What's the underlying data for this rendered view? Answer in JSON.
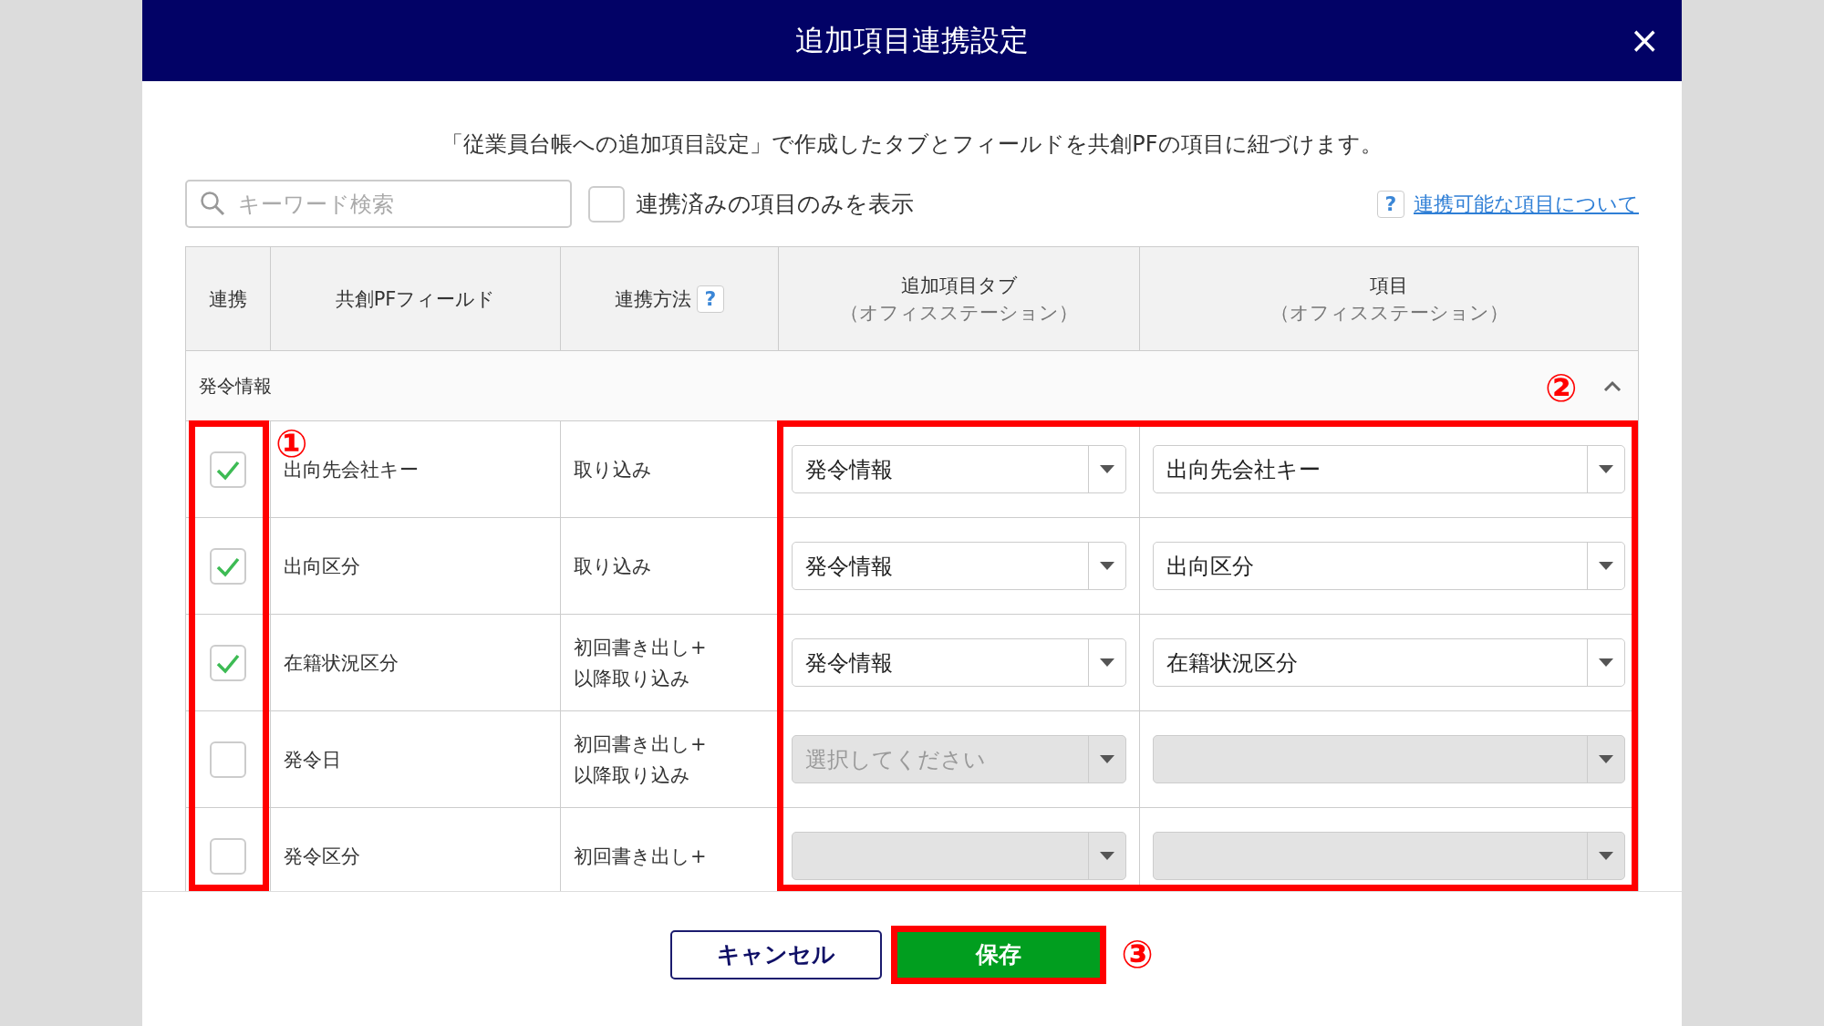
{
  "dialog": {
    "title": "追加項目連携設定",
    "close": "×"
  },
  "description": "「従業員台帳への追加項目設定」で作成したタブとフィールドを共創PFの項目に紐づけます。",
  "search": {
    "placeholder": "キーワード検索"
  },
  "filter": {
    "label": "連携済みの項目のみを表示",
    "checked": false
  },
  "help_link": {
    "icon": "?",
    "label": "連携可能な項目について"
  },
  "table": {
    "columns": [
      {
        "label": "連携"
      },
      {
        "label": "共創PFフィールド"
      },
      {
        "label": "連携方法",
        "help": "?"
      },
      {
        "label": "追加項目タブ",
        "sub": "（オフィスステーション）"
      },
      {
        "label": "項目",
        "sub": "（オフィスステーション）"
      }
    ],
    "group": {
      "label": "発令情報",
      "expanded": true
    },
    "rows": [
      {
        "linked": true,
        "field": "出向先会社キー",
        "method": [
          "取り込み"
        ],
        "tab": {
          "value": "発令情報",
          "disabled": false
        },
        "item": {
          "value": "出向先会社キー",
          "disabled": false
        }
      },
      {
        "linked": true,
        "field": "出向区分",
        "method": [
          "取り込み"
        ],
        "tab": {
          "value": "発令情報",
          "disabled": false
        },
        "item": {
          "value": "出向区分",
          "disabled": false
        }
      },
      {
        "linked": true,
        "field": "在籍状況区分",
        "method": [
          "初回書き出し+",
          "以降取り込み"
        ],
        "tab": {
          "value": "発令情報",
          "disabled": false
        },
        "item": {
          "value": "在籍状況区分",
          "disabled": false
        }
      },
      {
        "linked": false,
        "field": "発令日",
        "method": [
          "初回書き出し+",
          "以降取り込み"
        ],
        "tab": {
          "placeholder": "選択してください",
          "disabled": true
        },
        "item": {
          "disabled": true
        }
      },
      {
        "linked": false,
        "field": "発令区分",
        "method": [
          "初回書き出し+"
        ],
        "tab": {
          "disabled": true
        },
        "item": {
          "disabled": true
        }
      }
    ]
  },
  "markers": [
    "①",
    "②",
    "③"
  ],
  "buttons": {
    "cancel": "キャンセル",
    "save": "保存"
  }
}
